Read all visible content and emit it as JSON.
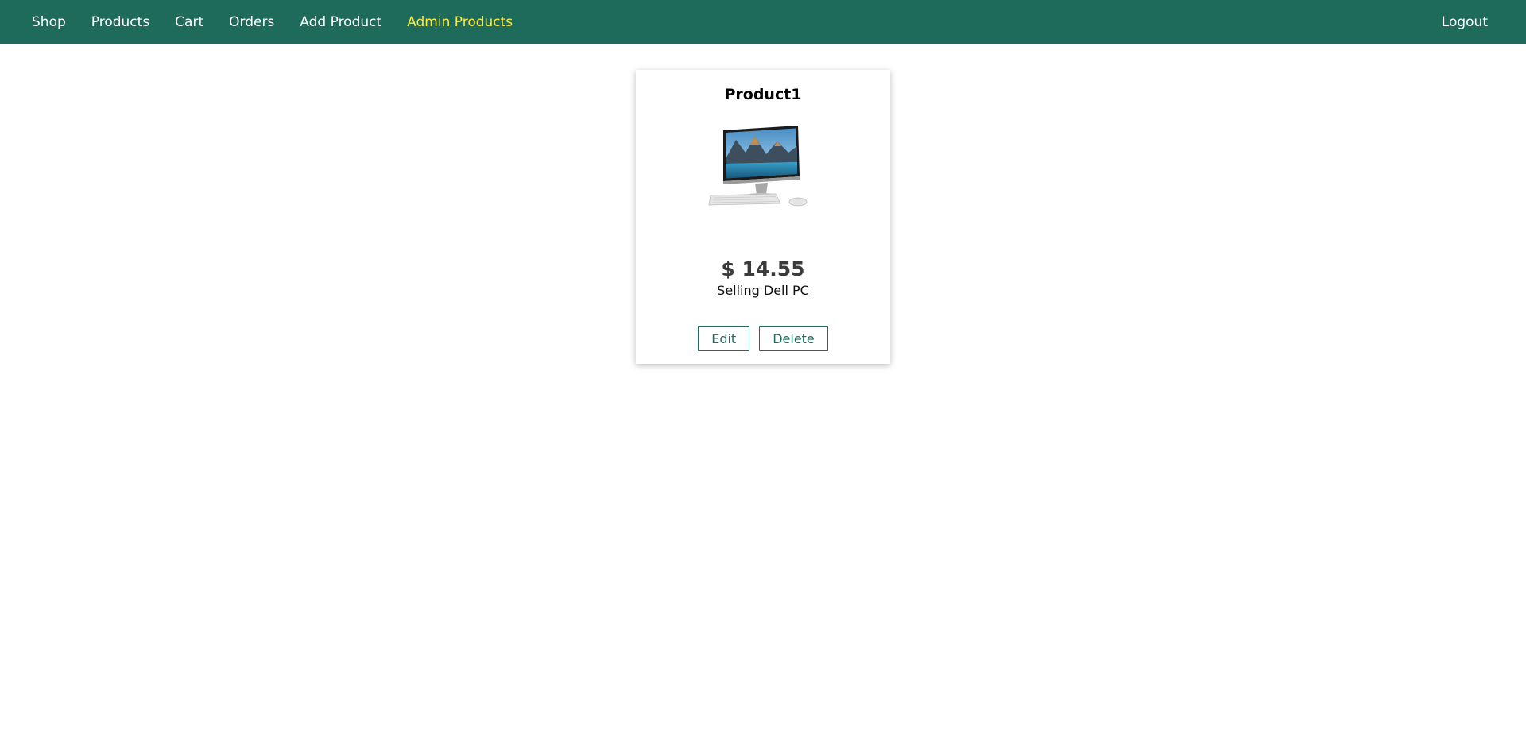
{
  "nav": {
    "items": [
      {
        "label": "Shop",
        "active": false
      },
      {
        "label": "Products",
        "active": false
      },
      {
        "label": "Cart",
        "active": false
      },
      {
        "label": "Orders",
        "active": false
      },
      {
        "label": "Add Product",
        "active": false
      },
      {
        "label": "Admin Products",
        "active": true
      }
    ],
    "logout_label": "Logout"
  },
  "colors": {
    "header_bg": "#1e6b5c",
    "active_link": "#ffeb3b",
    "button_accent": "#1e6b5c"
  },
  "products": [
    {
      "title": "Product1",
      "image_icon": "all-in-one-pc-image",
      "price": "$ 14.55",
      "description": "Selling Dell PC",
      "edit_label": "Edit",
      "delete_label": "Delete"
    }
  ]
}
